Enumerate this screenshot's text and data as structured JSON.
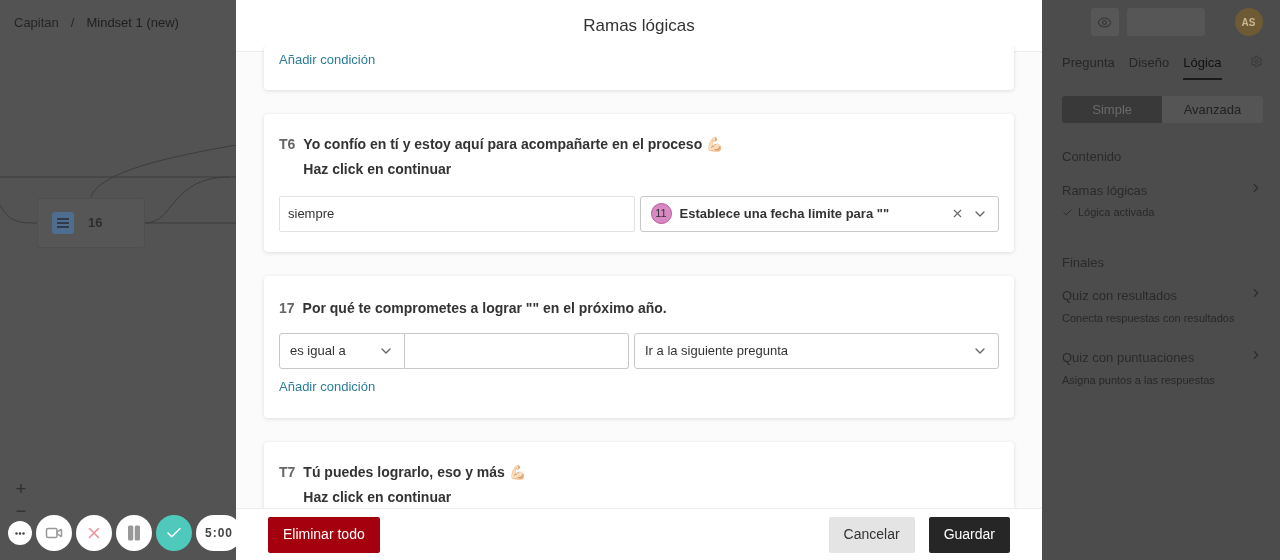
{
  "breadcrumb": [
    "Capitan",
    "Mindset 1 (new)"
  ],
  "breadcrumb_separator": "/",
  "canvas": {
    "node": {
      "label": "16"
    },
    "zoom_controls": [
      "+",
      "−"
    ]
  },
  "recorder": {
    "buttons": [
      {
        "kind": "more"
      },
      {
        "kind": "camera"
      },
      {
        "kind": "cancel"
      },
      {
        "kind": "pause"
      },
      {
        "kind": "done"
      }
    ],
    "timer": "5:00"
  },
  "modal": {
    "title": "Ramas lógicas",
    "blocks": [
      {
        "kind": "tail",
        "add_link": "Añadir condición"
      },
      {
        "kind": "always",
        "number": "T6",
        "title": "Yo confío en tí y estoy aquí para acompañarte en el proceso 💪🏻",
        "subtitle": "Haz click en continuar",
        "condition": "siempre",
        "target": {
          "badge": "11",
          "label": "Establece una fecha limite para \"\""
        }
      },
      {
        "kind": "condition",
        "number": "17",
        "title": "Por qué te comprometes a lograr \"\" en el próximo año.",
        "operator": "es igual a",
        "target": {
          "label": "Ir a la siguiente pregunta"
        },
        "add_link": "Añadir condición"
      },
      {
        "kind": "partial",
        "number": "T7",
        "title": "Tú puedes lograrlo, eso y más 💪🏻",
        "subtitle": "Haz click en continuar"
      }
    ],
    "footer": {
      "delete": "Eliminar todo",
      "cancel": "Cancelar",
      "save": "Guardar"
    }
  },
  "panel": {
    "avatar": "AS",
    "tabs": [
      {
        "label": "Pregunta",
        "selected": false
      },
      {
        "label": "Diseño",
        "selected": false
      },
      {
        "label": "Lógica",
        "selected": true
      }
    ],
    "modes": [
      {
        "label": "Simple",
        "selected": true
      },
      {
        "label": "Avanzada",
        "selected": false
      }
    ],
    "sections": [
      {
        "title": "Contenido",
        "items": [
          {
            "title": "Ramas lógicas",
            "subtitle": "Lógica activada",
            "checked": true
          }
        ]
      },
      {
        "title": "Finales",
        "items": [
          {
            "title": "Quiz con resultados",
            "subtitle": "Conecta respuestas con resultados",
            "checked": false
          },
          {
            "title": "Quiz con puntuaciones",
            "subtitle": "Asigna puntos a las respuestas",
            "checked": false
          }
        ]
      }
    ]
  }
}
